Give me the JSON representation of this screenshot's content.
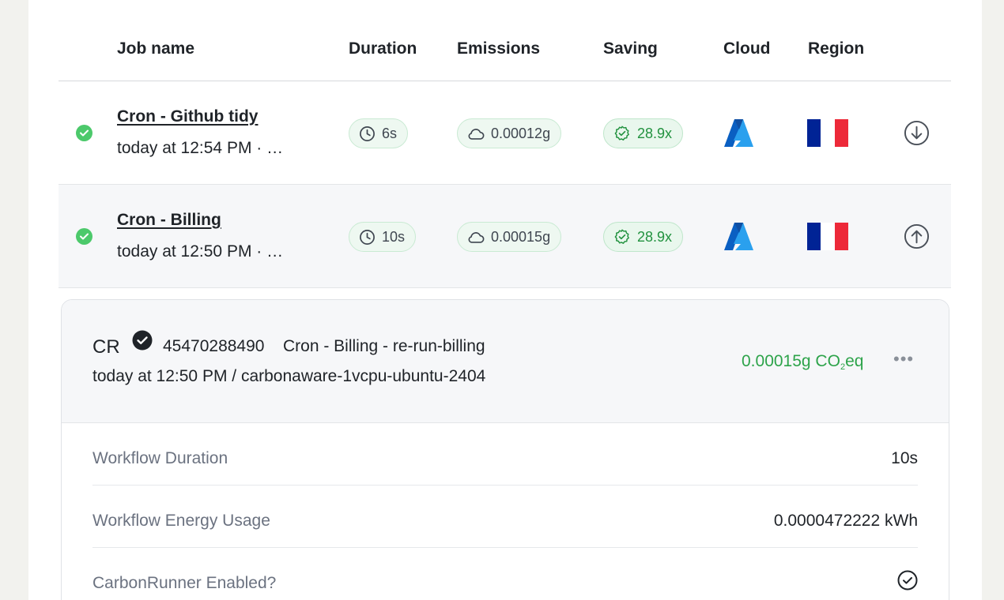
{
  "table": {
    "headers": {
      "job_name": "Job name",
      "duration": "Duration",
      "emissions": "Emissions",
      "saving": "Saving",
      "cloud": "Cloud",
      "region": "Region"
    },
    "rows": [
      {
        "status": "success",
        "name": "Cron - Github tidy",
        "time": "today at 12:54 PM · …",
        "duration": "6s",
        "emissions": "0.00012g",
        "saving": "28.9x",
        "cloud_icon": "azure-logo-icon",
        "region_icon": "france-flag-icon",
        "toggle_icon": "arrow-down-circle-icon",
        "expanded": false
      },
      {
        "status": "success",
        "name": "Cron - Billing",
        "time": "today at 12:50 PM · …",
        "duration": "10s",
        "emissions": "0.00015g",
        "saving": "28.9x",
        "cloud_icon": "azure-logo-icon",
        "region_icon": "france-flag-icon",
        "toggle_icon": "arrow-up-circle-icon",
        "expanded": true
      }
    ]
  },
  "detail": {
    "prefix": "CR",
    "run_id": "45470288490",
    "run_name": "Cron - Billing - re-run-billing",
    "meta": "today at 12:50 PM / carbonaware-1vcpu-ubuntu-2404",
    "emission_value": "0.00015g CO",
    "emission_sub": "2",
    "emission_suffix": "eq",
    "more_label": "•••",
    "fields": [
      {
        "label": "Workflow Duration",
        "value": "10s"
      },
      {
        "label": "Workflow Energy Usage",
        "value": "0.0000472222 kWh"
      },
      {
        "label": "CarbonRunner Enabled?",
        "value_icon": "check-circle-icon"
      }
    ]
  },
  "colors": {
    "success": "#4cc96b",
    "saving_text": "#22923f",
    "emission_text": "#2da34a",
    "azure_blue": "#0a6ed1",
    "flag_blue": "#002395",
    "flag_white": "#ffffff",
    "flag_red": "#ed2939"
  }
}
